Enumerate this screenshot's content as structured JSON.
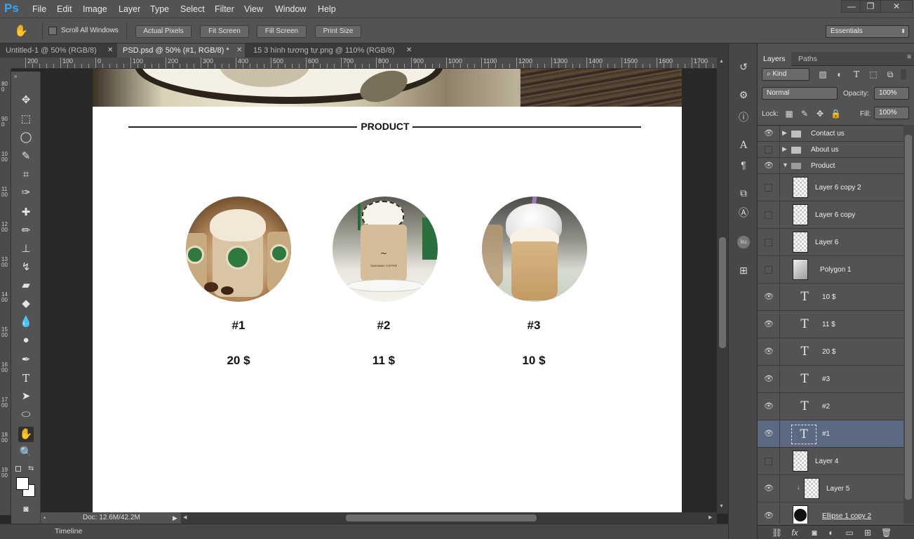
{
  "app": {
    "logo": "Ps",
    "menu": [
      "File",
      "Edit",
      "Image",
      "Layer",
      "Type",
      "Select",
      "Filter",
      "View",
      "Window",
      "Help"
    ],
    "window_controls": [
      "—",
      "❐",
      "✕"
    ]
  },
  "options": {
    "scroll_all_windows": "Scroll All Windows",
    "buttons": [
      "Actual Pixels",
      "Fit Screen",
      "Fill Screen",
      "Print Size"
    ],
    "workspace": "Essentials"
  },
  "tabs": [
    {
      "label": "Untitled-1 @ 50% (RGB/8)",
      "active": false
    },
    {
      "label": "PSD.psd @ 50% (#1, RGB/8) *",
      "active": true
    },
    {
      "label": "15 3 hình tương tự.png @ 110% (RGB/8)",
      "active": false
    }
  ],
  "ruler_top_labels": [
    "200",
    "100",
    "0",
    "100",
    "200",
    "300",
    "400",
    "500",
    "600",
    "700",
    "800",
    "900",
    "1000",
    "1100",
    "1200",
    "1300",
    "1400",
    "1500",
    "1600",
    "1700"
  ],
  "ruler_left_labels": [
    "800",
    "900",
    "1000",
    "1100",
    "1200",
    "1300",
    "1400",
    "1500",
    "1600",
    "1700",
    "1800",
    "1900"
  ],
  "canvas": {
    "section_title": "PRODUCT",
    "products": [
      {
        "number": "#1",
        "price": "20 $"
      },
      {
        "number": "#2",
        "price": "11 $"
      },
      {
        "number": "#3",
        "price": "10 $"
      }
    ],
    "cup_brand_text": "TAKEAWAY COFFEE"
  },
  "status": {
    "doc_size": "Doc: 12.6M/42.2M",
    "timeline": "Timeline"
  },
  "layers_panel": {
    "tabs": [
      "Layers",
      "Paths"
    ],
    "filter": "Kind",
    "blend_mode": "Normal",
    "opacity_label": "Opacity:",
    "opacity_value": "100%",
    "lock_label": "Lock:",
    "fill_label": "Fill:",
    "fill_value": "100%",
    "layers": [
      {
        "name": "Contact us",
        "kind": "group",
        "visible": true,
        "expanded": false
      },
      {
        "name": "About us",
        "kind": "group",
        "visible": false,
        "expanded": false
      },
      {
        "name": "Product",
        "kind": "group",
        "visible": true,
        "expanded": true
      },
      {
        "name": "Layer 6 copy 2",
        "kind": "pixel",
        "visible": false
      },
      {
        "name": "Layer 6 copy",
        "kind": "pixel",
        "visible": false
      },
      {
        "name": "Layer 6",
        "kind": "pixel",
        "visible": false
      },
      {
        "name": "Polygon 1",
        "kind": "shape",
        "visible": false
      },
      {
        "name": "10 $",
        "kind": "text",
        "visible": true
      },
      {
        "name": "11 $",
        "kind": "text",
        "visible": true
      },
      {
        "name": "20 $",
        "kind": "text",
        "visible": true
      },
      {
        "name": "#3",
        "kind": "text",
        "visible": true
      },
      {
        "name": "#2",
        "kind": "text",
        "visible": true
      },
      {
        "name": "#1",
        "kind": "text",
        "visible": true,
        "selected": true
      },
      {
        "name": "Layer 4",
        "kind": "pixel",
        "visible": false
      },
      {
        "name": "Layer 5",
        "kind": "pixel",
        "visible": true,
        "clipped": true
      },
      {
        "name": "Ellipse 1 copy 2",
        "kind": "shape",
        "visible": true
      }
    ]
  },
  "colors": {
    "chrome": "#535353",
    "canvas_bg": "#282828",
    "selection": "#5b6a82",
    "ps_blue": "#31a8ff"
  }
}
